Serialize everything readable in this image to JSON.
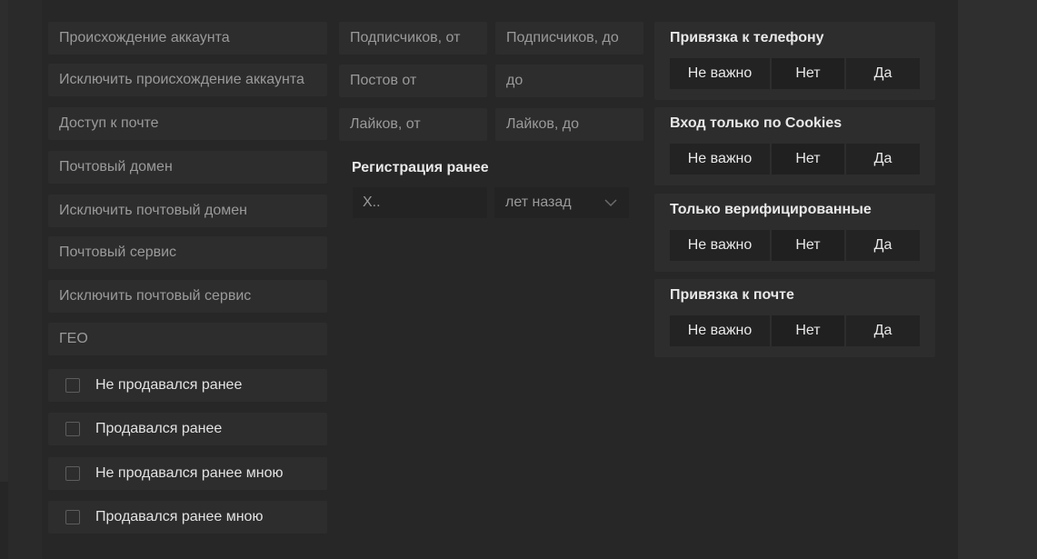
{
  "left_fields": [
    {
      "placeholder": "Происхождение аккаунта"
    },
    {
      "placeholder": "Исключить происхождение аккаунта"
    },
    {
      "placeholder": "Доступ к почте"
    },
    {
      "placeholder": "Почтовый домен"
    },
    {
      "placeholder": "Исключить почтовый домен"
    },
    {
      "placeholder": "Почтовый сервис"
    },
    {
      "placeholder": "Исключить почтовый сервис"
    },
    {
      "placeholder": "ГЕО"
    }
  ],
  "checkboxes": [
    {
      "label": "Не продавался ранее",
      "checked": false
    },
    {
      "label": "Продавался ранее",
      "checked": false
    },
    {
      "label": "Не продавался ранее мною",
      "checked": false
    },
    {
      "label": "Продавался ранее мною",
      "checked": false
    }
  ],
  "range_fields": [
    {
      "from": "Подписчиков, от",
      "to": "Подписчиков, до"
    },
    {
      "from": "Постов от",
      "to": "до"
    },
    {
      "from": "Лайков, от",
      "to": "Лайков, до"
    }
  ],
  "registration": {
    "title": "Регистрация ранее",
    "input_placeholder": "Х..",
    "unit_selected": "лет назад"
  },
  "toggle_groups": [
    {
      "title": "Привязка к телефону",
      "options": [
        "Не важно",
        "Нет",
        "Да"
      ]
    },
    {
      "title": "Вход только по Cookies",
      "options": [
        "Не важно",
        "Нет",
        "Да"
      ]
    },
    {
      "title": "Только верифицированные",
      "options": [
        "Не важно",
        "Нет",
        "Да"
      ]
    },
    {
      "title": "Привязка к почте",
      "options": [
        "Не важно",
        "Нет",
        "Да"
      ]
    }
  ],
  "icons": {
    "select_arrow": "chevron-down-icon"
  }
}
